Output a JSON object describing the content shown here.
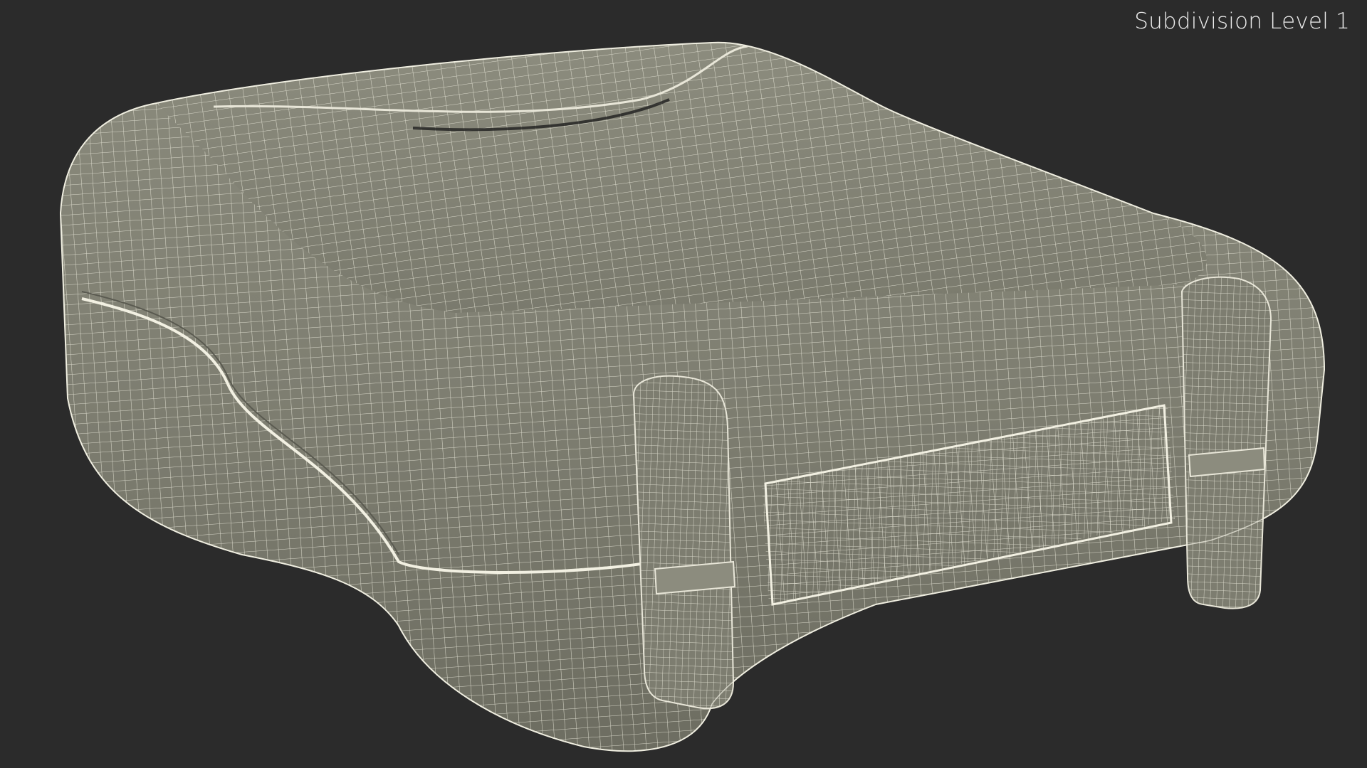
{
  "viewport": {
    "label": "Subdivision Level 1",
    "background_color": "#2b2b2b",
    "mesh_color": "#7b7b6e",
    "wire_color": "#e8e6d8",
    "subject": "wireframe-case-model"
  }
}
